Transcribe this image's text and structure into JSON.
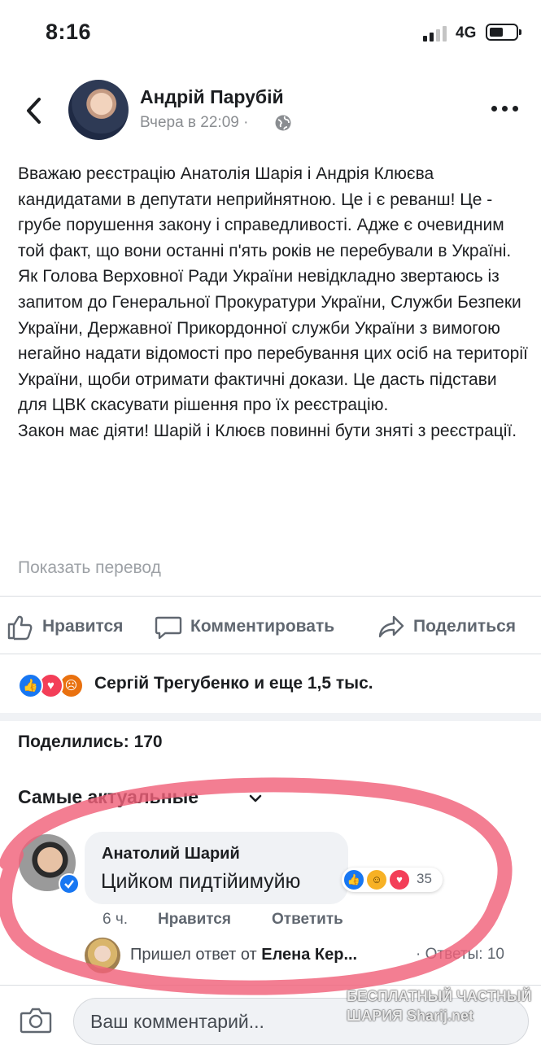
{
  "status_bar": {
    "time": "8:16",
    "network": "4G"
  },
  "post": {
    "author": "Андрій Парубій",
    "timestamp": "Вчера в 22:09 ·",
    "paragraphs": [
      "Вважаю реєстрацію Анатолія Шарія і Андрія Клюєва кандидатами в депутати неприйнятною. Це і є реванш! Це - грубе порушення закону і справедливості. Адже є очевидним той факт, що вони останні п'ять років не перебували в Україні. Як Голова Верховної Ради України невідкладно звертаюсь із запитом до Генеральної Прокуратури України, Служби Безпеки України, Державної Прикордонної служби України з вимогою негайно надати відомості про перебування цих осіб на території України, щоби отримати фактичні докази. Це дасть підстави для ЦВК скасувати рішення про їх реєстрацію.",
      "Закон має діяти! Шарій і Клюєв повинні бути зняті з реєстрації."
    ],
    "translate_label": "Показать перевод"
  },
  "actions": {
    "like": "Нравится",
    "comment": "Комментировать",
    "share": "Поделиться"
  },
  "reactions": {
    "summary": "Сергій Трегубенко и еще 1,5 тыс.",
    "icons": [
      "like-icon",
      "love-icon",
      "angry-icon"
    ]
  },
  "shares": "Поделились: 170",
  "sort_label": "Самые актуальные",
  "comment": {
    "author": "Анатолий Шарий",
    "text": "Цийком пидтійимуйю",
    "reaction_count": "35",
    "time": "6 ч.",
    "like_label": "Нравится",
    "reply_label": "Ответить",
    "reply_preview_prefix": "Пришел ответ от ",
    "reply_preview_name": "Елена Кер...",
    "reply_count": "· Ответы: 10"
  },
  "composer": {
    "placeholder": "Ваш комментарий..."
  },
  "watermark": {
    "line1": "БЕСПЛАТНЫЙ ЧАСТНЫЙ",
    "line2": "ШАРИЯ Sharij.net"
  },
  "colors": {
    "like_blue": "#1877f2",
    "love_red": "#f33e58",
    "angry_orange": "#e9710f",
    "haha_yellow": "#f7b125",
    "marker_red": "#f0617a"
  }
}
